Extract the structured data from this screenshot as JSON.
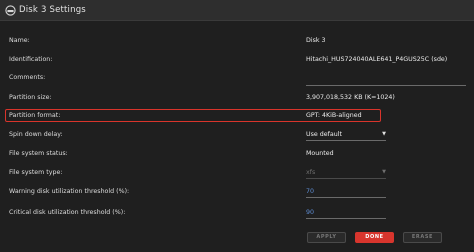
{
  "window": {
    "title": "Disk 3 Settings",
    "icon": "disk-icon"
  },
  "fields": {
    "name": {
      "label": "Name:",
      "value": "Disk 3"
    },
    "identification": {
      "label": "Identification:",
      "value": "Hitachi_HUS724040ALE641_P4GUS25C (sde)"
    },
    "comments": {
      "label": "Comments:",
      "value": ""
    },
    "partition_size": {
      "label": "Partition size:",
      "value": "3,907,018,532 KB (K=1024)"
    },
    "partition_format": {
      "label": "Partition format:",
      "value": "GPT: 4KiB-aligned"
    },
    "spin_down": {
      "label": "Spin down delay:",
      "value": "Use default"
    },
    "fs_status": {
      "label": "File system status:",
      "value": "Mounted"
    },
    "fs_type": {
      "label": "File system type:",
      "value": "xfs"
    },
    "warning_threshold": {
      "label": "Warning disk utilization threshold (%):",
      "value": "70"
    },
    "critical_threshold": {
      "label": "Critical disk utilization threshold (%):",
      "value": "90"
    }
  },
  "buttons": {
    "apply": "APPLY",
    "done": "DONE",
    "erase": "ERASE"
  },
  "colors": {
    "accent": "#d8352d",
    "link": "#5f8fd6"
  }
}
